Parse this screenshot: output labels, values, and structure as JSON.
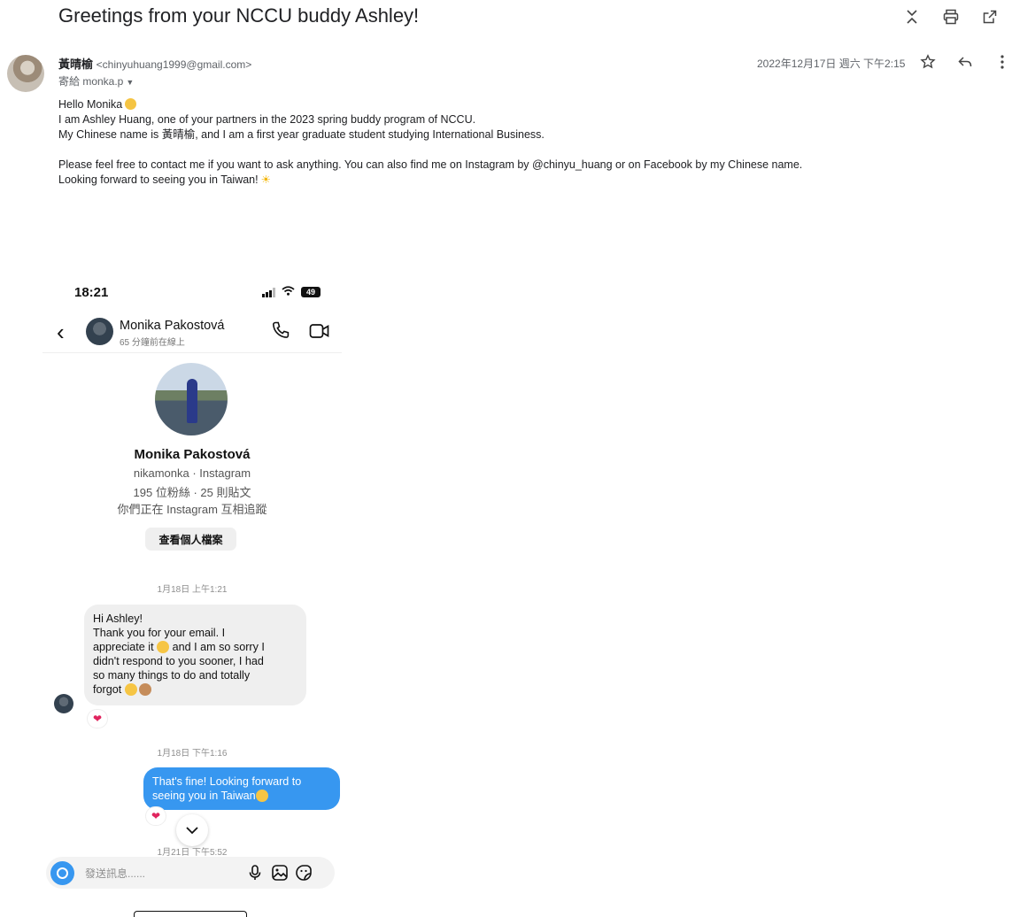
{
  "email": {
    "subject": "Greetings from your NCCU buddy Ashley!",
    "sender_name": "黃晴榆",
    "sender_email": "<chinyuhuang1999@gmail.com>",
    "to_line": "寄給 monka.p",
    "date": "2022年12月17日 週六 下午2:15",
    "body": {
      "greeting": "Hello Monika",
      "line1": "I am Ashley Huang, one of your partners in the 2023 spring buddy program of NCCU.",
      "line2": "My Chinese name is 黃晴榆, and I am a first year graduate student studying International Business.",
      "line3": "Please feel free to contact me if you want to ask anything. You can also find me on Instagram by @chinyu_huang or on Facebook by my Chinese name.",
      "line4": "Looking forward to seeing you in Taiwan!"
    },
    "icons": {
      "top": [
        "expand-collapse-icon",
        "print-icon",
        "open-in-new-window-icon"
      ],
      "row": [
        "star-icon",
        "reply-icon",
        "more-options-icon"
      ]
    }
  },
  "phone": {
    "status": {
      "time": "18:21",
      "battery": "49"
    },
    "chat_header": {
      "name": "Monika Pakostová",
      "status": "65 分鐘前在線上"
    },
    "profile": {
      "name": "Monika Pakostová",
      "handle": "nikamonka · Instagram",
      "stats": "195 位粉絲 · 25 則貼文",
      "mutual": "你們正在 Instagram 互相追蹤",
      "view_button": "查看個人檔案"
    },
    "messages": {
      "ts1": "1月18日 上午1:21",
      "incoming": [
        "Hi Ashley!",
        "Thank you for your email. I",
        "appreciate it",
        "and I am so sorry I",
        "didn't respond to you sooner, I had",
        "so many things to do and totally",
        "forgot"
      ],
      "ts2": "1月18日 下午1:16",
      "outgoing": [
        "That's fine! Looking forward to",
        "seeing you in Taiwan"
      ],
      "ts3": "1月21日 下午5:52",
      "reaction": "❤"
    },
    "composer": {
      "placeholder": "發送訊息......"
    }
  }
}
